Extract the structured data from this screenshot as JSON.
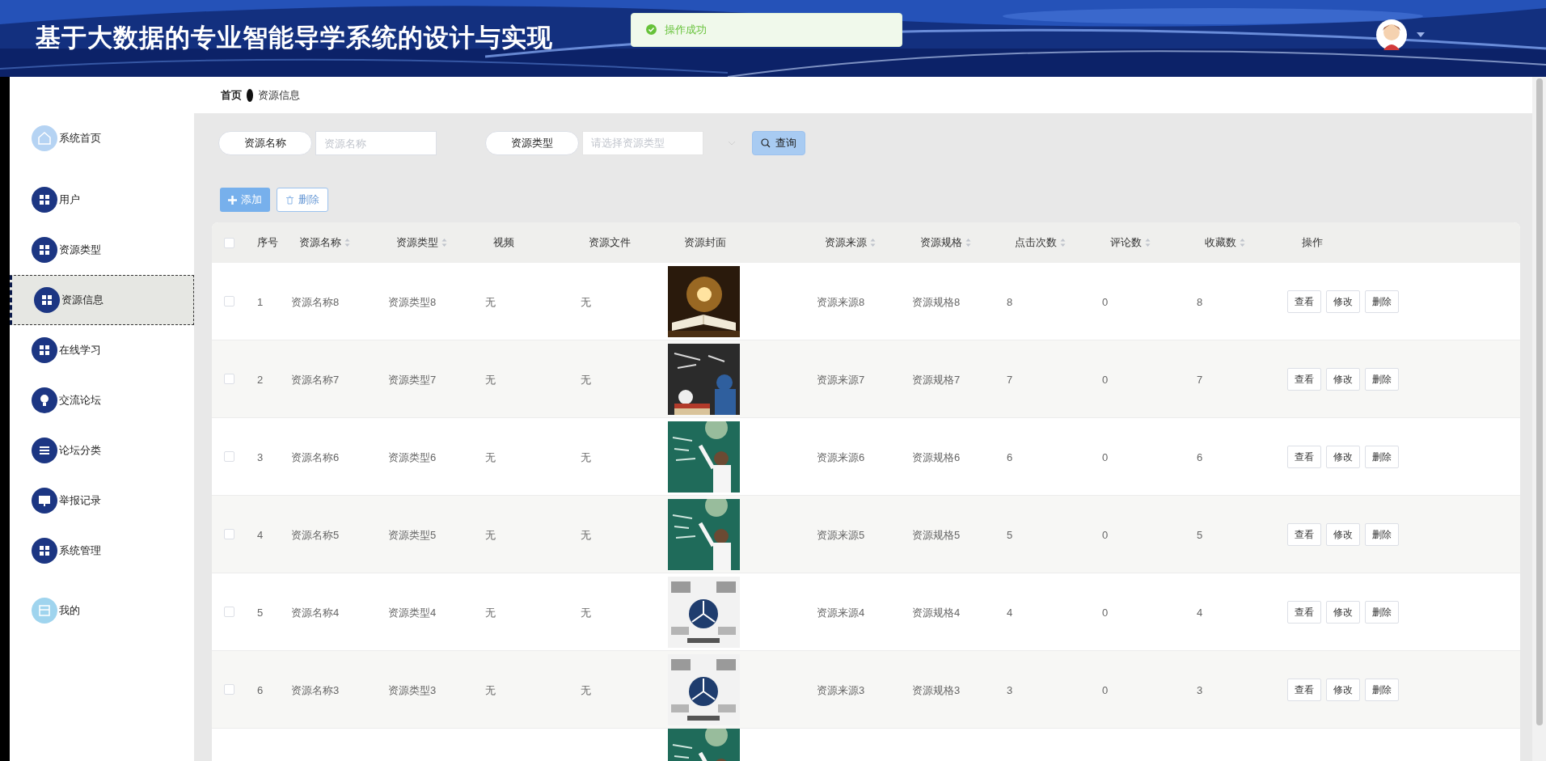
{
  "header": {
    "title": "基于大数据的专业智能导学系统的设计与实现",
    "toast": "操作成功"
  },
  "breadcrumb": [
    {
      "label": "首页"
    },
    {
      "label": "资源信息"
    }
  ],
  "sidebar": {
    "items": [
      {
        "label": "系统首页",
        "kind": "home",
        "selected": false
      },
      {
        "label": "用户",
        "kind": "grid",
        "selected": false
      },
      {
        "label": "资源类型",
        "kind": "grid",
        "selected": false
      },
      {
        "label": "资源信息",
        "kind": "grid",
        "selected": true
      },
      {
        "label": "在线学习",
        "kind": "grid",
        "selected": false
      },
      {
        "label": "交流论坛",
        "kind": "bulb",
        "selected": false
      },
      {
        "label": "论坛分类",
        "kind": "list",
        "selected": false
      },
      {
        "label": "举报记录",
        "kind": "monitor",
        "selected": false
      },
      {
        "label": "系统管理",
        "kind": "grid",
        "selected": false
      },
      {
        "label": "我的",
        "kind": "card",
        "selected": false
      }
    ]
  },
  "search": {
    "fields": [
      {
        "label": "资源名称",
        "placeholder": "资源名称",
        "kind": "text"
      },
      {
        "label": "资源类型",
        "placeholder": "请选择资源类型",
        "kind": "select"
      }
    ],
    "query_button": "查询"
  },
  "toolbar": [
    {
      "label": "添加",
      "kind": "add",
      "disabled": false
    },
    {
      "label": "删除",
      "kind": "delete",
      "disabled": true
    }
  ],
  "table": {
    "all_checked": false,
    "columns": [
      {
        "label": "序号",
        "sortable": false
      },
      {
        "label": "资源名称",
        "sortable": true
      },
      {
        "label": "资源类型",
        "sortable": true
      },
      {
        "label": "视频",
        "sortable": false
      },
      {
        "label": "资源文件",
        "sortable": false
      },
      {
        "label": "资源封面",
        "sortable": false
      },
      {
        "label": "资源来源",
        "sortable": true
      },
      {
        "label": "资源规格",
        "sortable": true
      },
      {
        "label": "点击次数",
        "sortable": true
      },
      {
        "label": "评论数",
        "sortable": true
      },
      {
        "label": "收藏数",
        "sortable": true
      },
      {
        "label": "操作",
        "sortable": false
      }
    ],
    "rows": [
      {
        "checked": false,
        "cells": [
          "1",
          "资源名称8",
          "资源类型8",
          "无",
          "无",
          "资源来源8",
          "资源规格8",
          "8",
          "0",
          "8"
        ],
        "actions": [
          "查看",
          "修改",
          "删除"
        ]
      },
      {
        "checked": false,
        "cells": [
          "2",
          "资源名称7",
          "资源类型7",
          "无",
          "无",
          "资源来源7",
          "资源规格7",
          "7",
          "0",
          "7"
        ],
        "actions": [
          "查看",
          "修改",
          "删除"
        ]
      },
      {
        "checked": false,
        "cells": [
          "3",
          "资源名称6",
          "资源类型6",
          "无",
          "无",
          "资源来源6",
          "资源规格6",
          "6",
          "0",
          "6"
        ],
        "actions": [
          "查看",
          "修改",
          "删除"
        ]
      },
      {
        "checked": false,
        "cells": [
          "4",
          "资源名称5",
          "资源类型5",
          "无",
          "无",
          "资源来源5",
          "资源规格5",
          "5",
          "0",
          "5"
        ],
        "actions": [
          "查看",
          "修改",
          "删除"
        ]
      },
      {
        "checked": false,
        "cells": [
          "5",
          "资源名称4",
          "资源类型4",
          "无",
          "无",
          "资源来源4",
          "资源规格4",
          "4",
          "0",
          "4"
        ],
        "actions": [
          "查看",
          "修改",
          "删除"
        ]
      },
      {
        "checked": false,
        "cells": [
          "6",
          "资源名称3",
          "资源类型3",
          "无",
          "无",
          "资源来源3",
          "资源规格3",
          "3",
          "0",
          "3"
        ],
        "actions": [
          "查看",
          "修改",
          "删除"
        ]
      },
      {
        "kind": "partial"
      }
    ]
  }
}
